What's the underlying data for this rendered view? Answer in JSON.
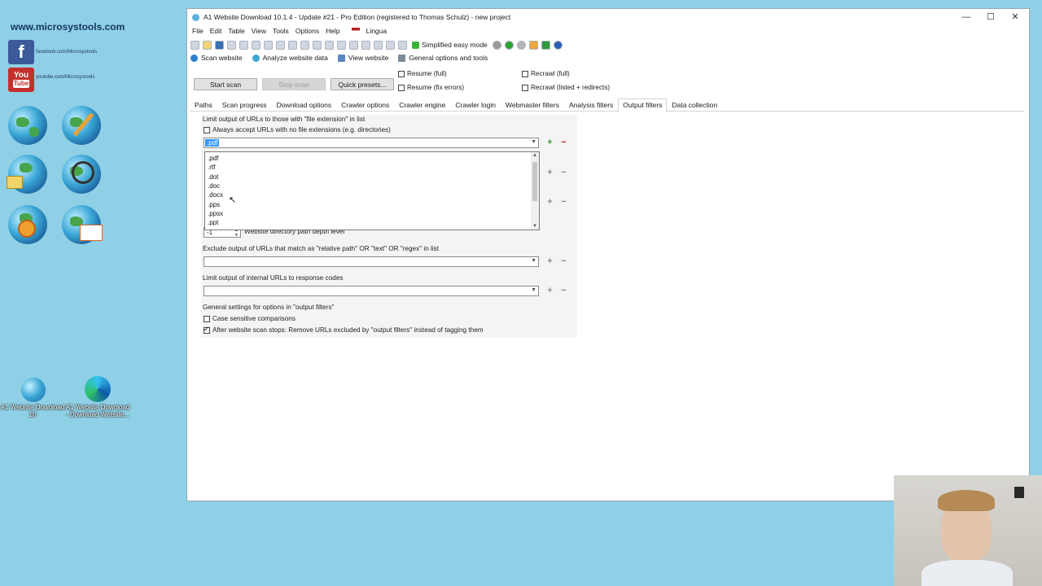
{
  "desktop": {
    "site_url": "www.microsystools.com",
    "facebook_label": "facebook.com/Microsystools",
    "youtube_label": "youtube.com/Microsystools",
    "shortcut1_label": "A1 Website Download 10",
    "shortcut2_label": "A1 Website Download - Download Website..."
  },
  "window": {
    "title": "A1 Website Download 10.1.4 - Update #21 - Pro Edition (registered to Thomas Schulz) - new project",
    "menu": [
      "File",
      "Edit",
      "Table",
      "View",
      "Tools",
      "Options",
      "Help",
      "Lingua"
    ],
    "simplified_mode_label": "Simplified easy mode",
    "main_tabs": [
      "Scan website",
      "Analyze website data",
      "View website",
      "General options and tools"
    ],
    "buttons": {
      "start": "Start scan",
      "stop": "Stop scan",
      "presets": "Quick presets..."
    },
    "options": {
      "resume_full": "Resume (full)",
      "resume_fix": "Resume (fix errors)",
      "recrawl_full": "Recrawl (full)",
      "recrawl_listed": "Recrawl (listed + redirects)"
    },
    "sub_tabs": [
      "Paths",
      "Scan progress",
      "Download options",
      "Crawler options",
      "Crawler engine",
      "Crawler login",
      "Webmaster filters",
      "Analysis filters",
      "Output filters",
      "Data collection"
    ],
    "active_sub_tab": "Output filters"
  },
  "filters": {
    "ext_group": "Limit output of URLs to those with \"file extension\" in list",
    "always_accept": "Always accept URLs with no file extensions (e.g. directories)",
    "ext_value": ".pdf",
    "ext_options": [
      ".pdf",
      ".rtf",
      ".dot",
      ".doc",
      ".docx",
      ".pps",
      ".ppsx",
      ".ppt"
    ],
    "depth_value": "-1",
    "depth_label": "Website directory path depth level",
    "exclude_group": "Exclude output of URLs that match as \"relative path\" OR \"text\" OR \"regex\" in list",
    "response_group": "Limit output of internal URLs to response codes",
    "general_group": "General settings for options in \"output filters\"",
    "case_sensitive": "Case sensitive comparisons",
    "after_scan": "After website scan stops: Remove URLs excluded by \"output filters\" instead of tagging them"
  },
  "colors": {
    "accent": "#3399ff",
    "desktop": "#8fd0e6"
  }
}
